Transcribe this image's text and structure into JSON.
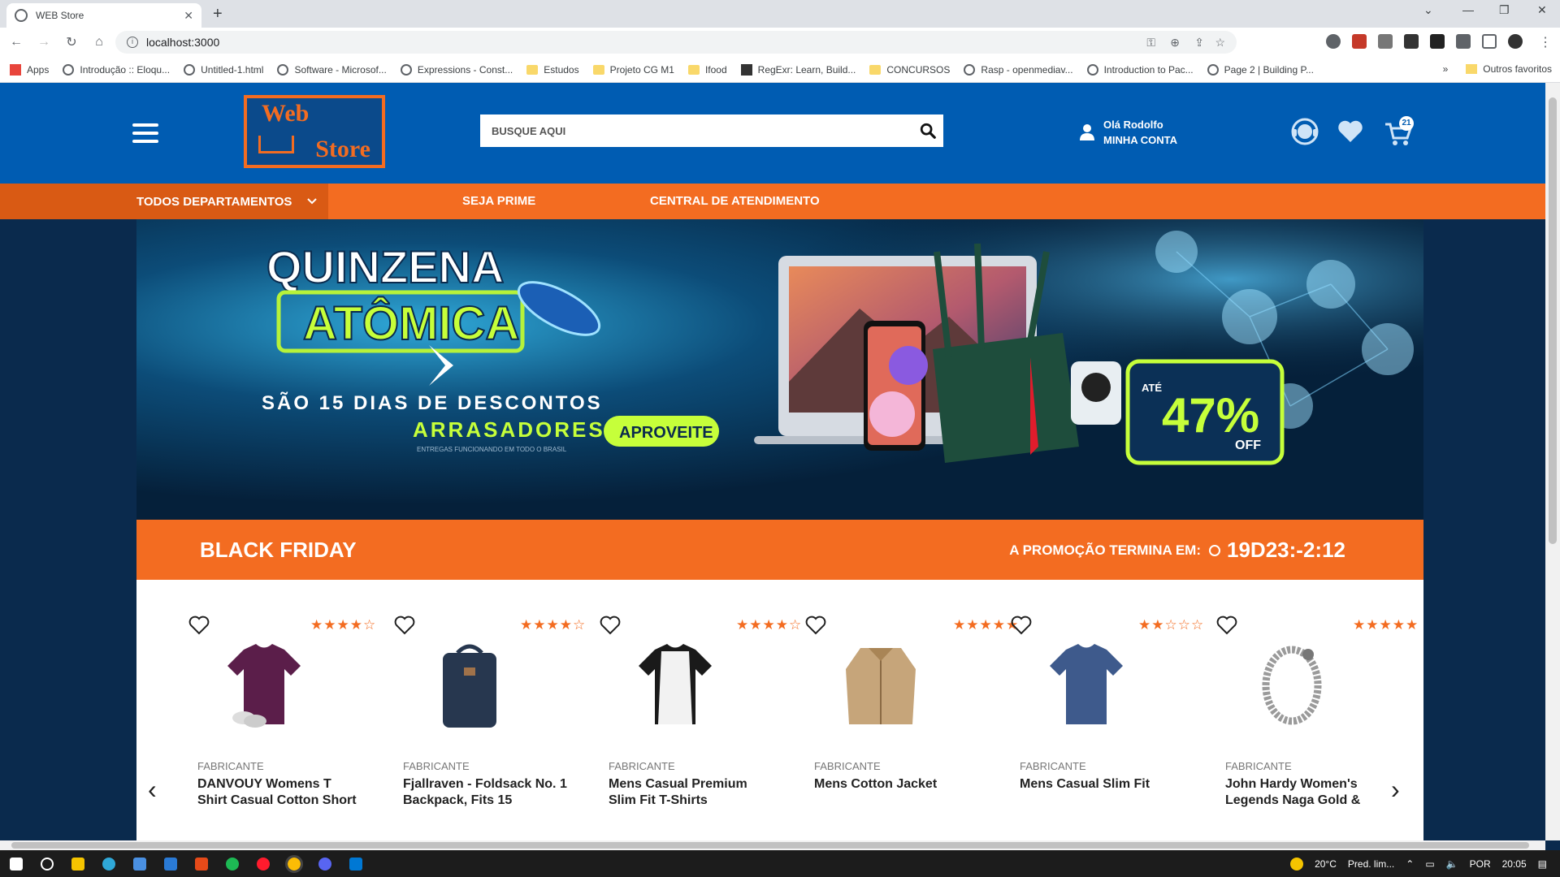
{
  "browser": {
    "tab_title": "WEB Store",
    "url": "localhost:3000",
    "bookmarks": [
      {
        "label": "Apps",
        "icon": "apps-grid-icon"
      },
      {
        "label": "Introdução :: Eloqu...",
        "icon": "globe-icon"
      },
      {
        "label": "Untitled-1.html",
        "icon": "globe-icon"
      },
      {
        "label": "Software - Microsof...",
        "icon": "globe-icon"
      },
      {
        "label": "Expressions - Const...",
        "icon": "globe-icon"
      },
      {
        "label": "Estudos",
        "icon": "folder-icon"
      },
      {
        "label": "Projeto CG M1",
        "icon": "folder-icon"
      },
      {
        "label": "Ifood",
        "icon": "folder-icon"
      },
      {
        "label": "RegExr: Learn, Build...",
        "icon": "regexr-icon"
      },
      {
        "label": "CONCURSOS",
        "icon": "folder-icon"
      },
      {
        "label": "Rasp - openmediav...",
        "icon": "globe-icon"
      },
      {
        "label": "Introduction to Pac...",
        "icon": "globe-icon"
      },
      {
        "label": "Page 2 | Building P...",
        "icon": "globe-icon"
      }
    ],
    "other_bookmarks": "Outros favoritos",
    "overflow": "»"
  },
  "header": {
    "logo_top": "Web",
    "logo_bottom": "Store",
    "search_placeholder": "BUSQUE AQUI",
    "greeting": "Olá Rodolfo",
    "account": "MINHA CONTA",
    "cart_count": "21"
  },
  "nav": {
    "departments": "TODOS DEPARTAMENTOS",
    "prime": "SEJA PRIME",
    "support": "CENTRAL DE ATENDIMENTO"
  },
  "banner": {
    "title1": "QUINZENA",
    "title2": "ATÔMICA",
    "line1": "SÃO 15 DIAS DE DESCONTOS",
    "line2": "ARRASADORES",
    "small": "ENTREGAS FUNCIONANDO EM TODO O BRASIL",
    "cta": "APROVEITE",
    "ate": "ATÉ",
    "percent": "47%",
    "off": "OFF"
  },
  "black_friday": {
    "title": "BLACK FRIDAY",
    "ends_label": "A PROMOÇÃO TERMINA EM:",
    "timer": "19D23:-2:12"
  },
  "products": [
    {
      "maker": "FABRICANTE",
      "name": "DANVOUY Womens T Shirt Casual Cotton Short",
      "rating": 3.5,
      "stars": "★★★★☆",
      "image": "purple-tshirt",
      "color": "#5b1e4a"
    },
    {
      "maker": "FABRICANTE",
      "name": "Fjallraven - Foldsack No. 1 Backpack, Fits 15",
      "rating": 3.5,
      "stars": "★★★★☆",
      "image": "backpack",
      "color": "#27374f"
    },
    {
      "maker": "FABRICANTE",
      "name": "Mens Casual Premium Slim Fit T-Shirts",
      "rating": 4,
      "stars": "★★★★☆",
      "image": "raglan-shirt",
      "color": "#1a1a1a"
    },
    {
      "maker": "FABRICANTE",
      "name": "Mens Cotton Jacket",
      "rating": 4.5,
      "stars": "★★★★★",
      "image": "jacket",
      "color": "#c6a57a"
    },
    {
      "maker": "FABRICANTE",
      "name": "Mens Casual Slim Fit",
      "rating": 2,
      "stars": "★★☆☆☆",
      "image": "slim-shirt",
      "color": "#3e5a8c"
    },
    {
      "maker": "FABRICANTE",
      "name": "John Hardy Women's Legends Naga Gold &",
      "rating": 4.5,
      "stars": "★★★★★",
      "image": "bracelet",
      "color": "#9a9a9a"
    }
  ],
  "taskbar": {
    "weather": "20°C",
    "weather_desc": "Pred. lim...",
    "lang": "POR",
    "time": "20:05"
  }
}
